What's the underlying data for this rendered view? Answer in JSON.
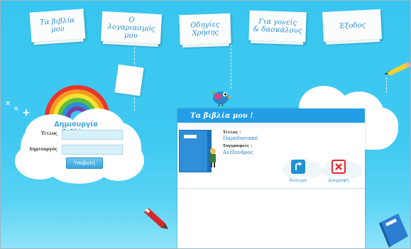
{
  "nav": {
    "tabs": [
      {
        "label": "Τα βιβλία\nμου"
      },
      {
        "label": "Ο λογαριασμός\nμου"
      },
      {
        "label": "Οδηγίες\nΧρήσης"
      },
      {
        "label": "Για γονείς\n& δασκάλους"
      },
      {
        "label": "Έξοδος"
      }
    ]
  },
  "create_form": {
    "title": "Δημιουργία βιβλίου",
    "title_label": "Τίτλος",
    "author_label": "Δημιουργός",
    "title_value": "",
    "author_value": "",
    "submit_label": "Υποβολή"
  },
  "my_books": {
    "header": "Τα βιβλία μου !",
    "book": {
      "title_label": "Τίτλος :",
      "title_value": "Παραδοσιακό",
      "authors_label": "Συγγραφείς :",
      "authors_value": "Αλέξανδρος"
    },
    "open_label": "Άνοιγμα",
    "delete_label": "Διαγραφή"
  },
  "colors": {
    "sky": "#3fc9f1",
    "header_blue": "#229ee6",
    "link_blue": "#2680c9",
    "delete_red": "#e2262b"
  },
  "icons": [
    "open-book-icon",
    "delete-x-icon",
    "pencil-icon",
    "bird-icon",
    "crayon-icon",
    "book-icon",
    "rainbow-icon"
  ]
}
